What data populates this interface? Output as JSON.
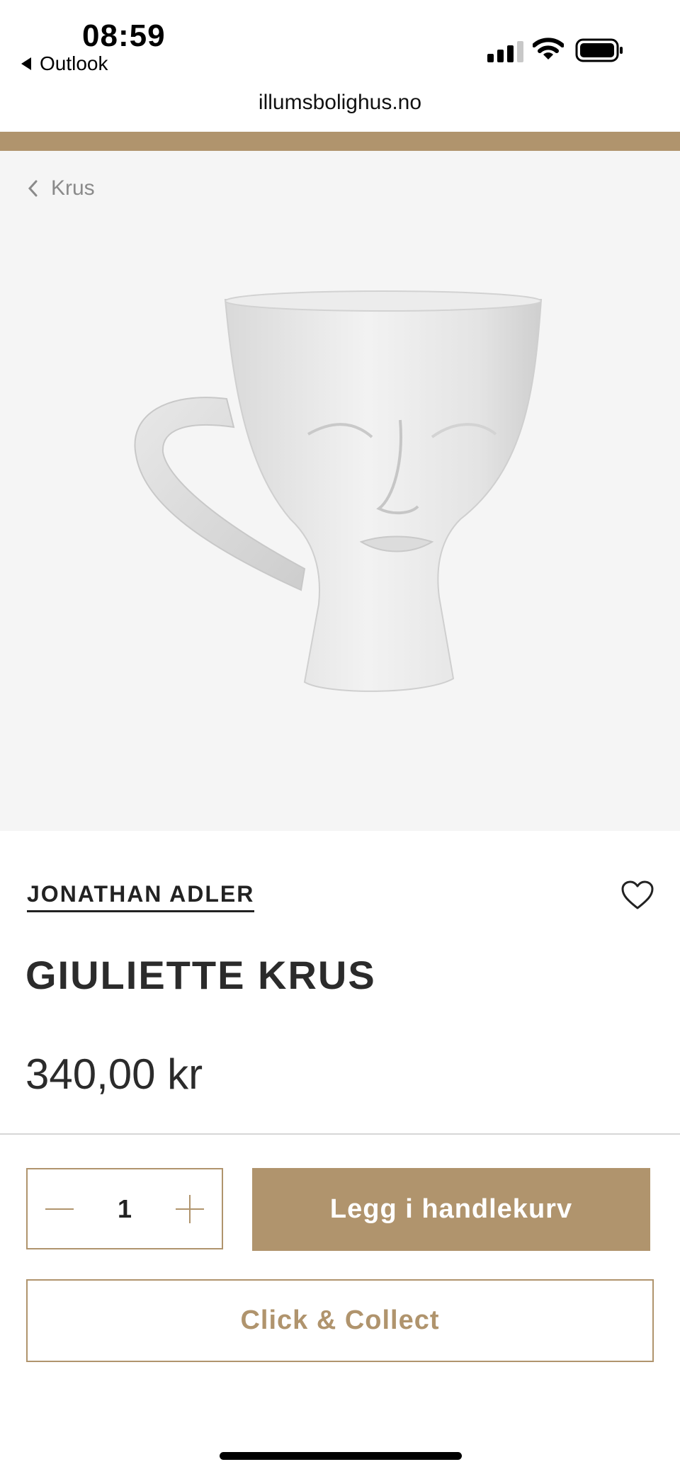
{
  "status": {
    "time": "08:59",
    "back_app": "Outlook"
  },
  "browser": {
    "url": "illumsbolighus.no"
  },
  "breadcrumb": {
    "label": "Krus"
  },
  "product": {
    "brand": "JONATHAN ADLER",
    "title": "GIULIETTE KRUS",
    "price": "340,00 kr",
    "quantity": "1"
  },
  "actions": {
    "add_to_cart": "Legg i handlekurv",
    "click_collect": "Click & Collect"
  },
  "colors": {
    "accent": "#b0946d",
    "hero_bg": "#f5f5f5"
  }
}
